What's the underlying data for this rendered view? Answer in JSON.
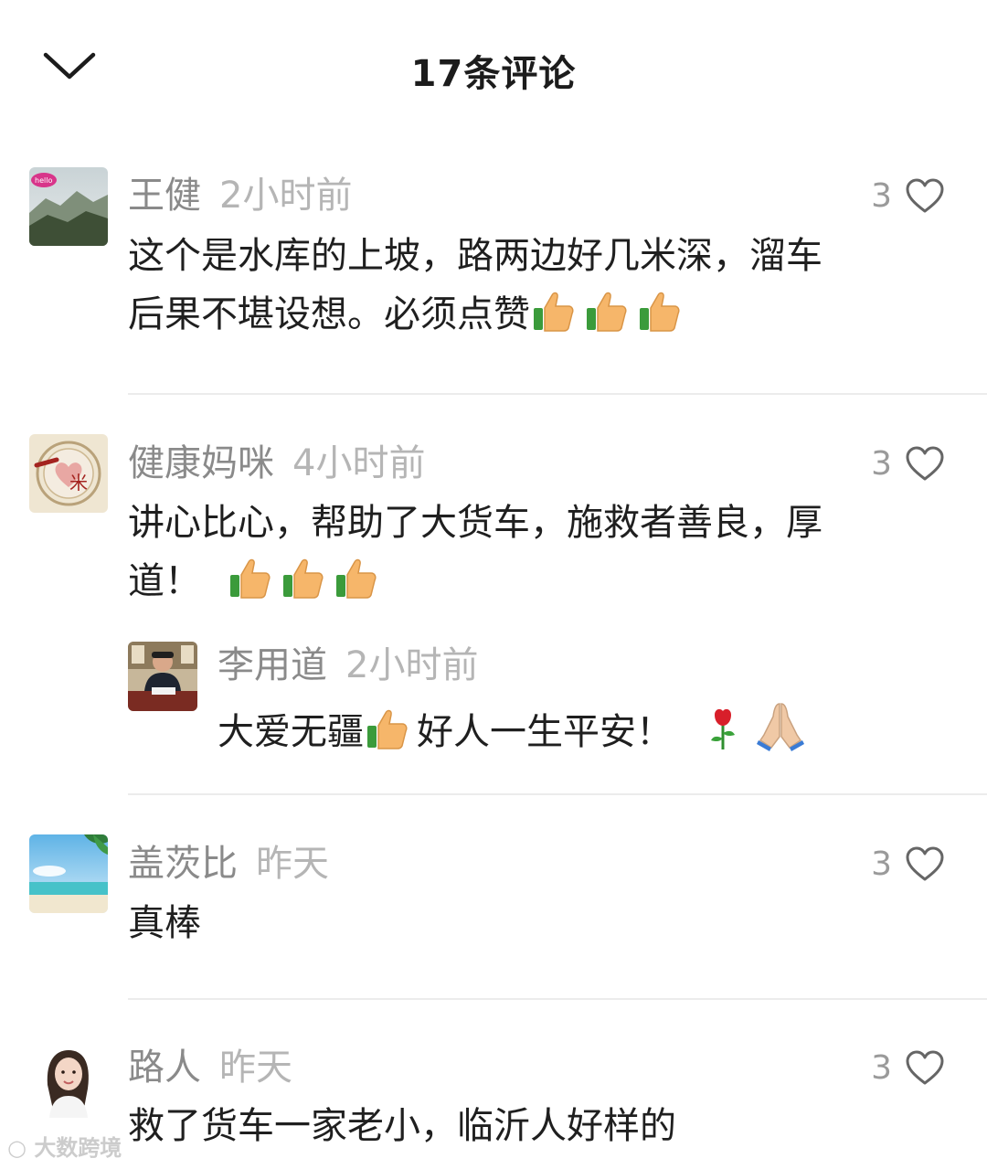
{
  "header": {
    "title": "17条评论"
  },
  "comments": [
    {
      "username": "王健",
      "time": "2小时前",
      "likes": "3",
      "text_line1": "这个是水库的上坡，路两边好几米深，溜车",
      "text_line2": "后果不堪设想。必须点赞"
    },
    {
      "username": "健康妈咪",
      "time": "4小时前",
      "likes": "3",
      "text_line1": "讲心比心，帮助了大货车，施救者善良，厚",
      "text_line2": "道！",
      "reply": {
        "username": "李用道",
        "time": "2小时前",
        "text_part1": "大爱无疆",
        "text_part2": "好人一生平安！"
      }
    },
    {
      "username": "盖茨比",
      "time": "昨天",
      "likes": "3",
      "text_line1": "真棒"
    },
    {
      "username": "路人",
      "time": "昨天",
      "likes": "3",
      "text_line1": "救了货车一家老小，临沂人好样的"
    }
  ],
  "watermark": "大数跨境",
  "colors": {
    "username": "#8a8a8a",
    "time": "#b5b5b5",
    "text": "#1f1f1f",
    "divider": "#ececec"
  }
}
